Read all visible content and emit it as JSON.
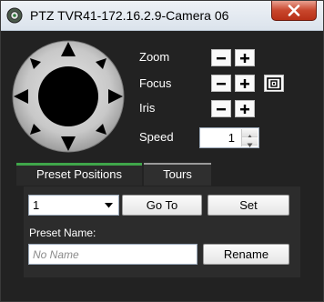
{
  "window": {
    "title": "PTZ  TVR41-172.16.2.9-Camera 06",
    "icon": "camera-gear-icon",
    "close_icon": "close-icon"
  },
  "ptz": {
    "zoom_label": "Zoom",
    "focus_label": "Focus",
    "iris_label": "Iris",
    "speed_label": "Speed",
    "speed_value": "1",
    "minus_glyph": "minus-icon",
    "plus_glyph": "plus-icon",
    "autofocus_icon": "autofocus-icon"
  },
  "tabs": [
    {
      "label": "Preset Positions",
      "active": true
    },
    {
      "label": "Tours",
      "active": false
    }
  ],
  "preset": {
    "selected": "1",
    "go_to_label": "Go To",
    "set_label": "Set",
    "name_label": "Preset Name:",
    "name_placeholder": "No Name",
    "rename_label": "Rename"
  }
}
